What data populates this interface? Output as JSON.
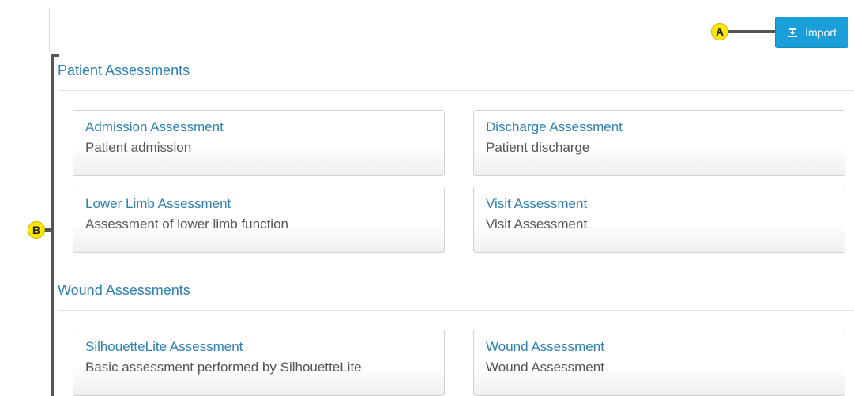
{
  "toolbar": {
    "import_label": "Import",
    "import_icon": "import-icon",
    "accent": "#1a9fdb"
  },
  "callouts": {
    "a": "A",
    "b": "B",
    "color": "#ffe600"
  },
  "sections": [
    {
      "title": "Patient Assessments",
      "cards": [
        {
          "title": "Admission Assessment",
          "description": "Patient admission"
        },
        {
          "title": "Discharge Assessment",
          "description": "Patient discharge"
        },
        {
          "title": "Lower Limb Assessment",
          "description": "Assessment of lower limb function"
        },
        {
          "title": "Visit Assessment",
          "description": "Visit Assessment"
        }
      ]
    },
    {
      "title": "Wound Assessments",
      "cards": [
        {
          "title": "SilhouetteLite Assessment",
          "description": "Basic assessment performed by SilhouetteLite"
        },
        {
          "title": "Wound Assessment",
          "description": "Wound Assessment"
        }
      ]
    }
  ]
}
